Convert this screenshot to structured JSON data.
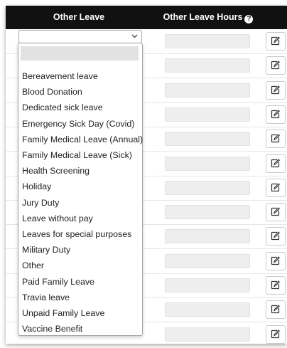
{
  "header": {
    "col_other_leave": "Other Leave",
    "col_other_leave_hours": "Other Leave Hours",
    "help_glyph": "?"
  },
  "select": {
    "selected_value": "",
    "icon": "chevron-down-icon"
  },
  "dropdown": {
    "options": [
      "",
      "Bereavement leave",
      "Blood Donation",
      "Dedicated sick leave",
      "Emergency Sick Day (Covid)",
      "Family Medical Leave (Annual)",
      "Family Medical Leave (Sick)",
      "Health Screening",
      "Holiday",
      "Jury Duty",
      "Leave without pay",
      "Leaves for special purposes",
      "Military Duty",
      "Other",
      "Paid Family Leave",
      "Travia leave",
      "Unpaid Family Leave",
      "Vaccine Benefit"
    ]
  },
  "rows_count": 13,
  "colors": {
    "header_bg": "#111111",
    "input_bg": "#eeeeee"
  },
  "icons": {
    "edit": "edit-icon",
    "help": "question-circle-icon"
  }
}
